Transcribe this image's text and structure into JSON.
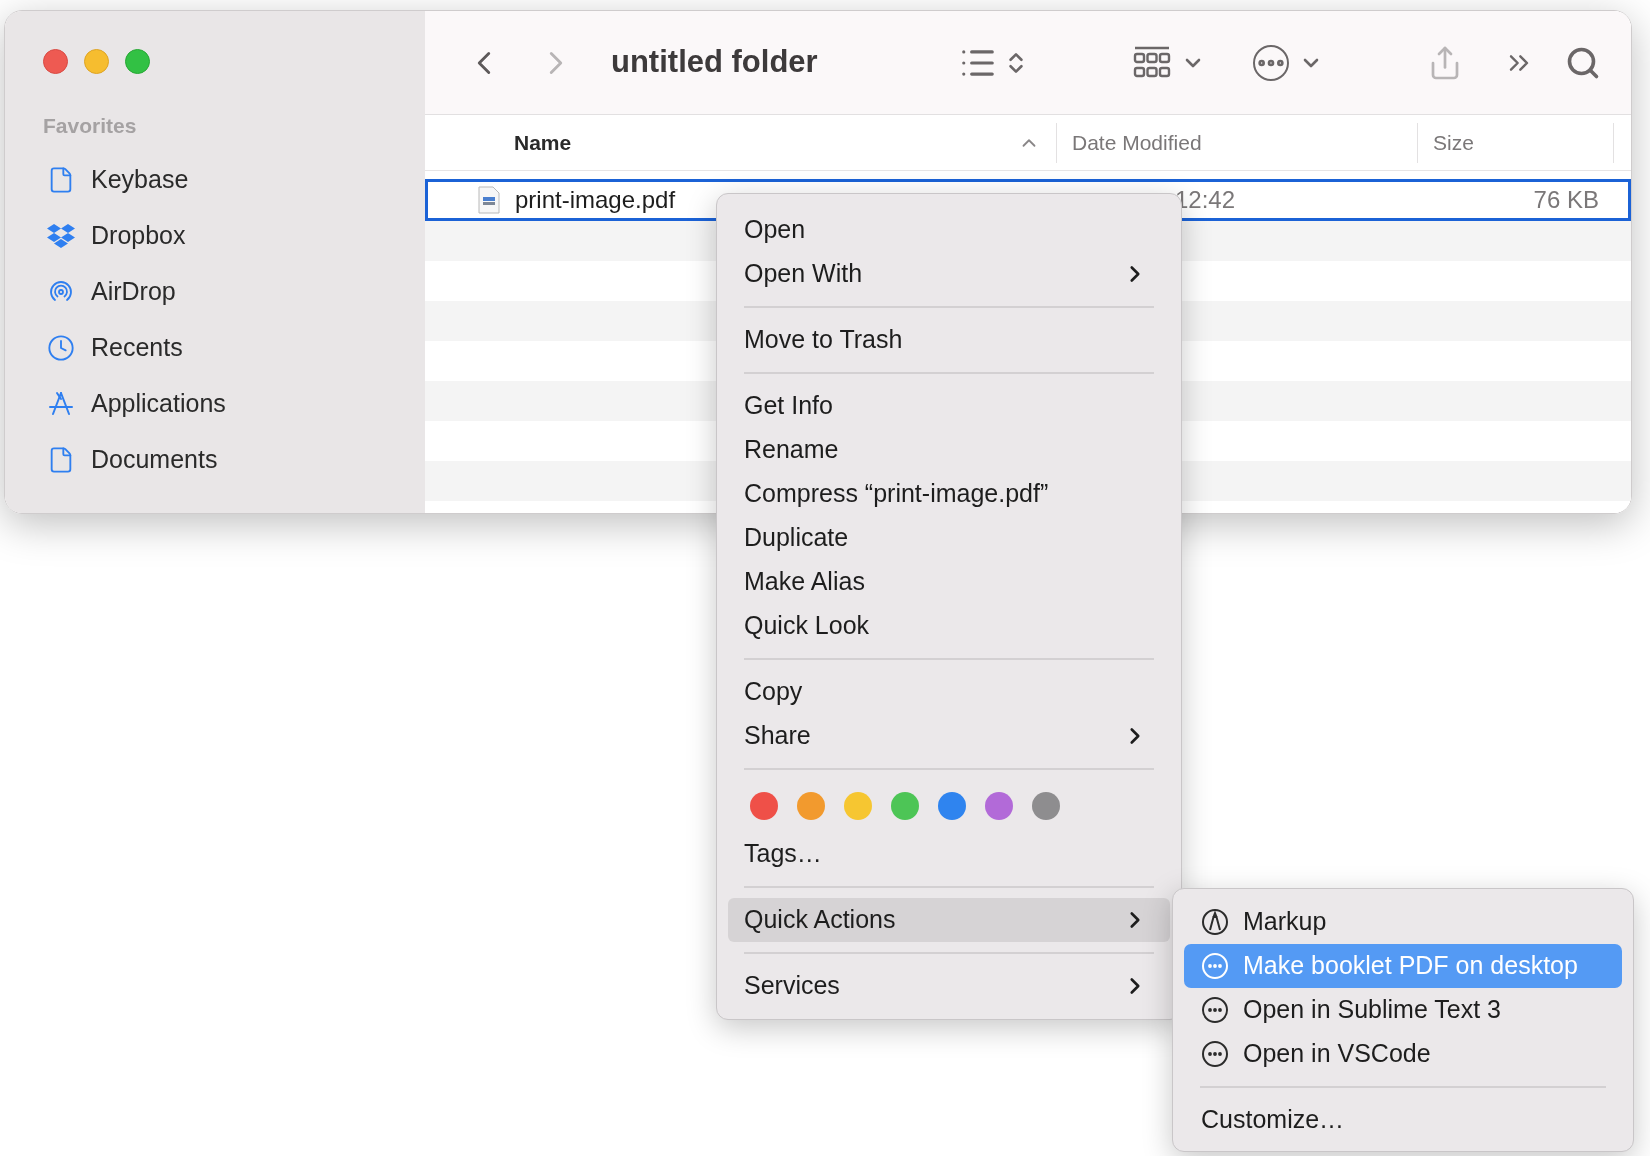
{
  "window": {
    "title": "untitled folder"
  },
  "toolbar": {
    "back": {
      "disabled": false
    },
    "forward": {
      "disabled": true
    }
  },
  "sidebar": {
    "heading": "Favorites",
    "items": [
      {
        "label": "Keybase",
        "kind": "document",
        "selected": false
      },
      {
        "label": "Dropbox",
        "kind": "dropbox",
        "selected": false
      },
      {
        "label": "AirDrop",
        "kind": "airdrop",
        "selected": false
      },
      {
        "label": "Recents",
        "kind": "clock",
        "selected": false
      },
      {
        "label": "Applications",
        "kind": "apps",
        "selected": false
      },
      {
        "label": "Documents",
        "kind": "document",
        "selected": false
      }
    ]
  },
  "table": {
    "columns": [
      {
        "label": "Name",
        "sorted": true
      },
      {
        "label": "Date Modified",
        "sorted": false
      },
      {
        "label": "Size",
        "sorted": false
      }
    ],
    "rows": [
      {
        "name": "print-image.pdf",
        "date_modified": "12:42",
        "size": "76 KB",
        "selected": true
      }
    ]
  },
  "context_menu": {
    "items": [
      {
        "kind": "item",
        "label": "Open",
        "submenu": false,
        "selected": false
      },
      {
        "kind": "item",
        "label": "Open With",
        "submenu": true,
        "selected": false
      },
      {
        "kind": "separator"
      },
      {
        "kind": "item",
        "label": "Move to Trash",
        "submenu": false,
        "selected": false
      },
      {
        "kind": "separator"
      },
      {
        "kind": "item",
        "label": "Get Info",
        "submenu": false,
        "selected": false
      },
      {
        "kind": "item",
        "label": "Rename",
        "submenu": false,
        "selected": false
      },
      {
        "kind": "item",
        "label": "Compress “print-image.pdf”",
        "submenu": false,
        "selected": false
      },
      {
        "kind": "item",
        "label": "Duplicate",
        "submenu": false,
        "selected": false
      },
      {
        "kind": "item",
        "label": "Make Alias",
        "submenu": false,
        "selected": false
      },
      {
        "kind": "item",
        "label": "Quick Look",
        "submenu": false,
        "selected": false
      },
      {
        "kind": "separator"
      },
      {
        "kind": "item",
        "label": "Copy",
        "submenu": false,
        "selected": false
      },
      {
        "kind": "item",
        "label": "Share",
        "submenu": true,
        "selected": false
      },
      {
        "kind": "separator"
      },
      {
        "kind": "tags",
        "colors": [
          {
            "color": "#ef5048"
          },
          {
            "color": "#f29a2e"
          },
          {
            "color": "#f6c631"
          },
          {
            "color": "#4dc556"
          },
          {
            "color": "#2f84ef"
          },
          {
            "color": "#b26ad8"
          },
          {
            "color": "#8e8d8f"
          }
        ]
      },
      {
        "kind": "item",
        "label": "Tags…",
        "submenu": false,
        "selected": false
      },
      {
        "kind": "separator"
      },
      {
        "kind": "item",
        "label": "Quick Actions",
        "submenu": true,
        "selected": true
      },
      {
        "kind": "separator"
      },
      {
        "kind": "item",
        "label": "Services",
        "submenu": true,
        "selected": false
      }
    ]
  },
  "quick_actions_menu": {
    "items": [
      {
        "kind": "markup",
        "label": "Markup",
        "selected": false
      },
      {
        "kind": "action",
        "label": "Make booklet PDF on desktop",
        "selected": true
      },
      {
        "kind": "action",
        "label": "Open in Sublime Text 3",
        "selected": false
      },
      {
        "kind": "action",
        "label": "Open in VSCode",
        "selected": false
      },
      {
        "kind": "separator"
      },
      {
        "kind": "item",
        "label": "Customize…",
        "selected": false
      }
    ]
  }
}
